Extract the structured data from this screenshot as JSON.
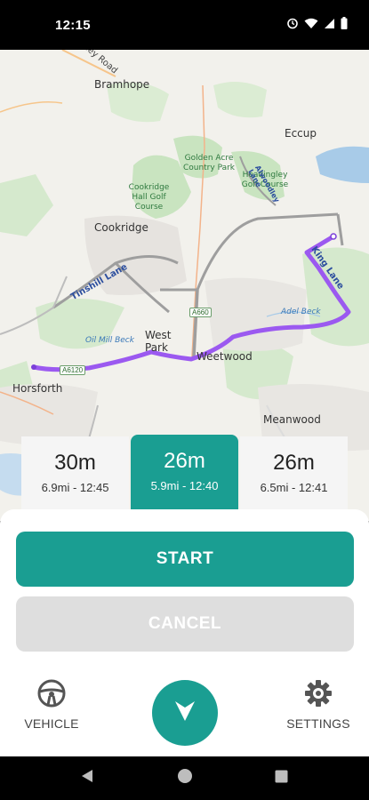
{
  "status_bar": {
    "time": "12:15",
    "icons": [
      "alarm-icon",
      "wifi-icon",
      "signal-icon",
      "battery-icon"
    ]
  },
  "map": {
    "places": [
      "Bramhope",
      "Eccup",
      "Cookridge",
      "West Park",
      "Weetwood",
      "Horsforth",
      "Meanwood"
    ],
    "areas": [
      "Golden Acre Country Park",
      "Cookridge Hall Golf Course",
      "Headingley Golf Course"
    ],
    "roads": [
      "Otley Road",
      "Tinshill Lane",
      "King Lane",
      "Alwoodley Lane"
    ],
    "road_numbers": [
      "A6120",
      "A660"
    ],
    "water": [
      "Adel Beck",
      "Oil Mill Beck"
    ],
    "route_color": "#9b59f0"
  },
  "routes": [
    {
      "time": "30m",
      "info": "6.9mi - 12:45",
      "selected": false
    },
    {
      "time": "26m",
      "info": "5.9mi - 12:40",
      "selected": true
    },
    {
      "time": "26m",
      "info": "6.5mi - 12:41",
      "selected": false
    }
  ],
  "actions": {
    "start_label": "START",
    "cancel_label": "CANCEL"
  },
  "bottom_nav": {
    "vehicle_label": "VEHICLE",
    "settings_label": "SETTINGS",
    "center_icon": "navigation-arrow-icon"
  },
  "colors": {
    "accent": "#1a9e92",
    "cancel_bg": "#dedede"
  }
}
